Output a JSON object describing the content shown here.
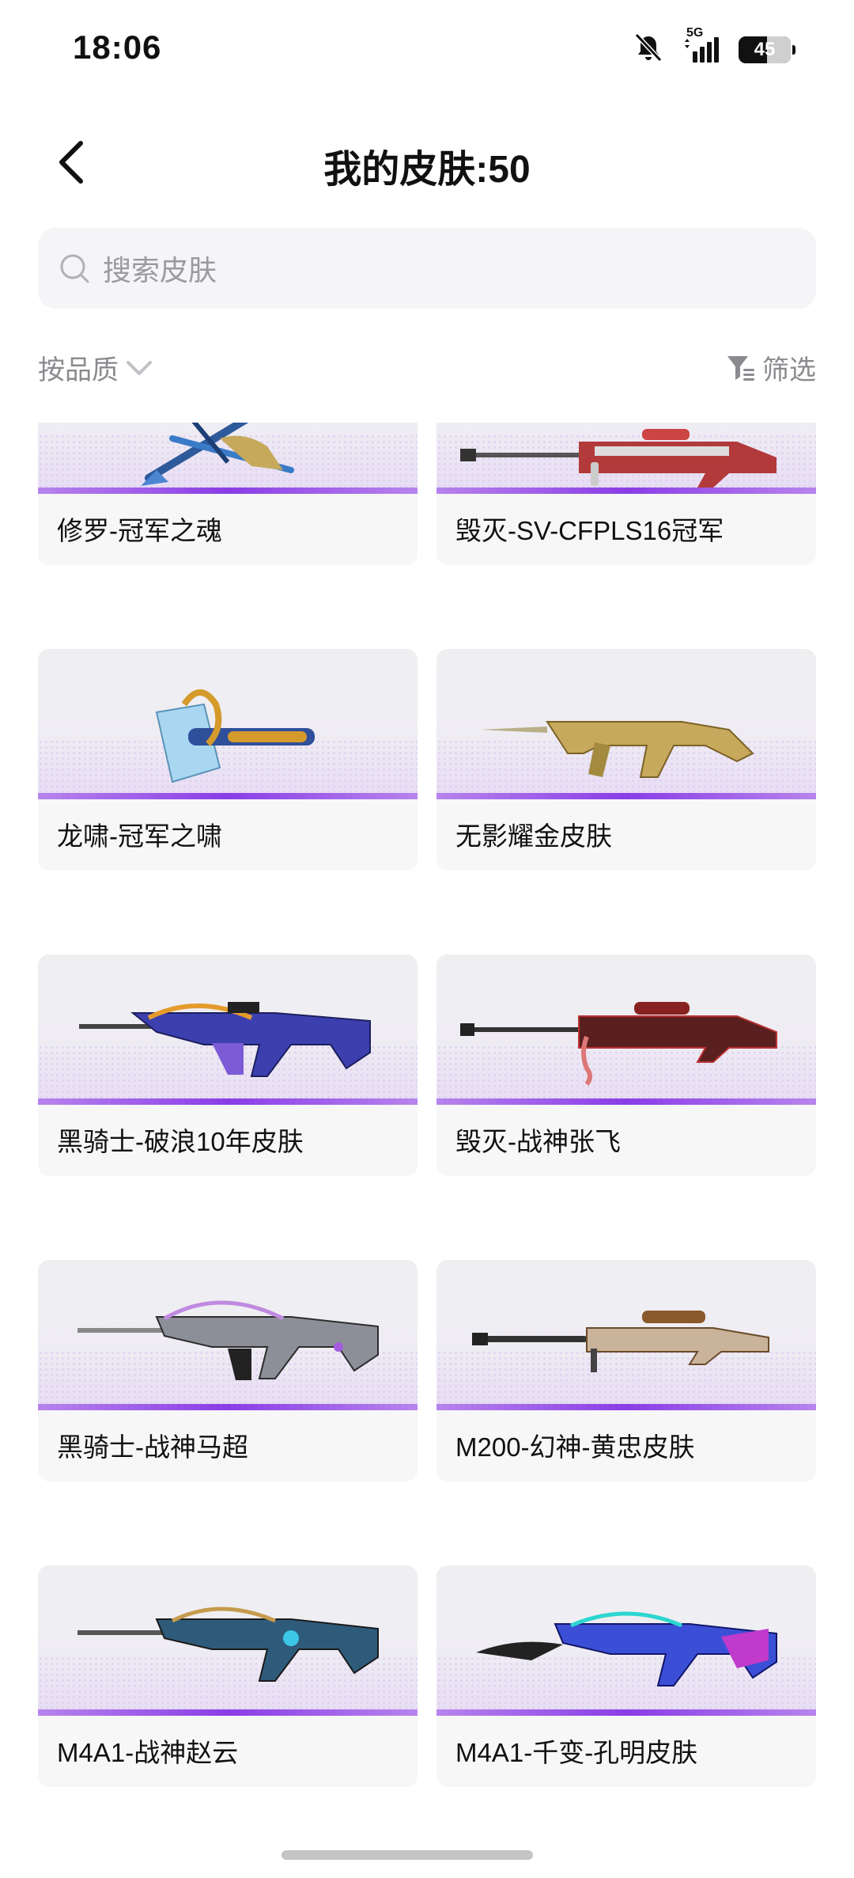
{
  "status_bar": {
    "time": "18:06",
    "network": "5G",
    "battery": "45"
  },
  "header": {
    "title": "我的皮肤:50"
  },
  "search": {
    "placeholder": "搜索皮肤"
  },
  "filters": {
    "sort_label": "按品质",
    "filter_label": "筛选"
  },
  "skins": [
    {
      "name": "修罗-冠军之魂",
      "icon": "crossbow-icon"
    },
    {
      "name": "毁灭-SV-CFPLS16冠军",
      "icon": "sniper-rifle-icon"
    },
    {
      "name": "龙啸-冠军之啸",
      "icon": "axe-icon"
    },
    {
      "name": "无影耀金皮肤",
      "icon": "assault-rifle-icon"
    },
    {
      "name": "黑骑士-破浪10年皮肤",
      "icon": "assault-rifle-icon"
    },
    {
      "name": "毁灭-战神张飞",
      "icon": "sniper-rifle-icon"
    },
    {
      "name": "黑骑士-战神马超",
      "icon": "assault-rifle-icon"
    },
    {
      "name": "M200-幻神-黄忠皮肤",
      "icon": "sniper-rifle-icon"
    },
    {
      "name": "M4A1-战神赵云",
      "icon": "assault-rifle-icon"
    },
    {
      "name": "M4A1-千变-孔明皮肤",
      "icon": "assault-rifle-icon"
    }
  ],
  "colors": {
    "accent": "#8a3de6",
    "background": "#ffffff",
    "card": "#f7f7f8"
  }
}
